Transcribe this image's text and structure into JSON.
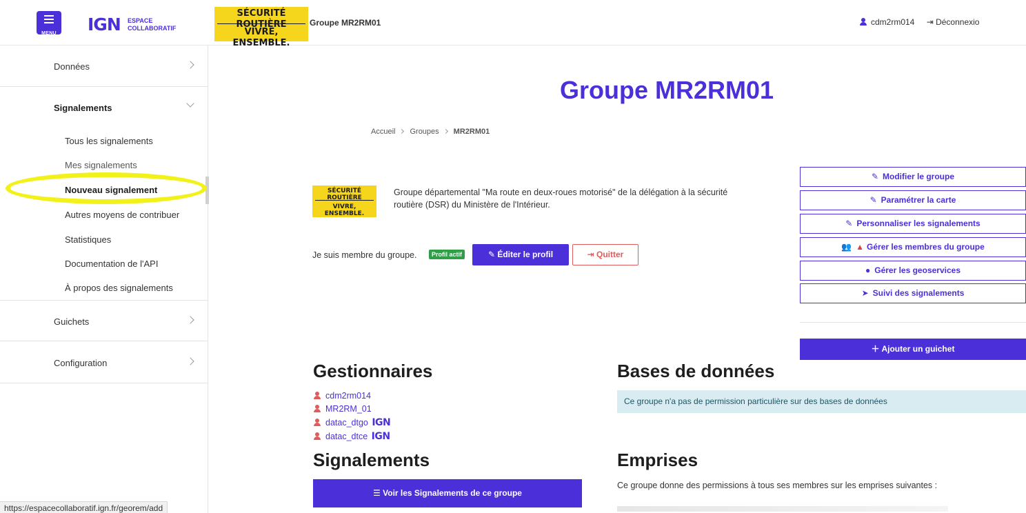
{
  "header": {
    "menu_label": "MENU",
    "ign_logo": "IGN",
    "ign_sub_line1": "ESPACE",
    "ign_sub_line2": "COLLABORATIF",
    "banner_line1": "SÉCURITÉ ROUTIÈRE",
    "banner_line2": "VIVRE, ENSEMBLE.",
    "title": "Groupe MR2RM01",
    "username": "cdm2rm014",
    "logout_label": "Déconnexio"
  },
  "sidebar": {
    "sections": [
      {
        "label": "Données"
      },
      {
        "label": "Signalements"
      },
      {
        "label": "Guichets"
      },
      {
        "label": "Configuration"
      }
    ],
    "sub_items": [
      {
        "label": "Tous les signalements"
      },
      {
        "label": "Mes signalements"
      },
      {
        "label": "Nouveau signalement"
      },
      {
        "label": "Autres moyens de contribuer"
      },
      {
        "label": "Statistiques"
      },
      {
        "label": "Documentation de l'API"
      },
      {
        "label": "À propos des signalements"
      }
    ]
  },
  "status_url": "https://espacecollaboratif.ign.fr/georem/add",
  "main": {
    "title": "Groupe MR2RM01",
    "breadcrumb": [
      "Accueil",
      "Groupes",
      "MR2RM01"
    ],
    "mini_banner_line1": "SÉCURITÉ ROUTIÈRE",
    "mini_banner_line2": "VIVRE, ENSEMBLE.",
    "description": "Groupe départemental \"Ma route en deux-roues motorisé\" de la délégation à la sécurité routière (DSR) du Ministère de l'Intérieur.",
    "member_text": "Je suis membre du groupe.",
    "profile_badge": "Profil actif",
    "edit_profile": "Éditer le profil",
    "quit": "Quitter",
    "actions": [
      {
        "label": "Modifier le groupe"
      },
      {
        "label": "Paramétrer la carte"
      },
      {
        "label": "Personnaliser les signalements"
      },
      {
        "label": "Gérer les membres du groupe"
      },
      {
        "label": "Gérer les geoservices"
      },
      {
        "label": "Suivi des signalements"
      }
    ],
    "add_guichet": "Ajouter un guichet",
    "managers_title": "Gestionnaires",
    "managers": [
      {
        "name": "cdm2rm014",
        "ign": ""
      },
      {
        "name": "MR2RM_01",
        "ign": ""
      },
      {
        "name": "datac_dtgo",
        "ign": "IGN"
      },
      {
        "name": "datac_dtce",
        "ign": "IGN"
      }
    ],
    "databases_title": "Bases de données",
    "databases_info": "Ce groupe n'a pas de permission particulière sur des bases de données",
    "reports_title": "Signalements",
    "view_reports": "Voir les Signalements de ce groupe",
    "emprises_title": "Emprises",
    "emprises_text": "Ce groupe donne des permissions à tous ses membres sur les emprises suivantes :"
  },
  "colors": {
    "accent": "#4b2fd8",
    "highlight": "#f2f21a",
    "banner_yellow": "#f5d61d",
    "danger": "#e05c5c",
    "success": "#2f9e47"
  }
}
